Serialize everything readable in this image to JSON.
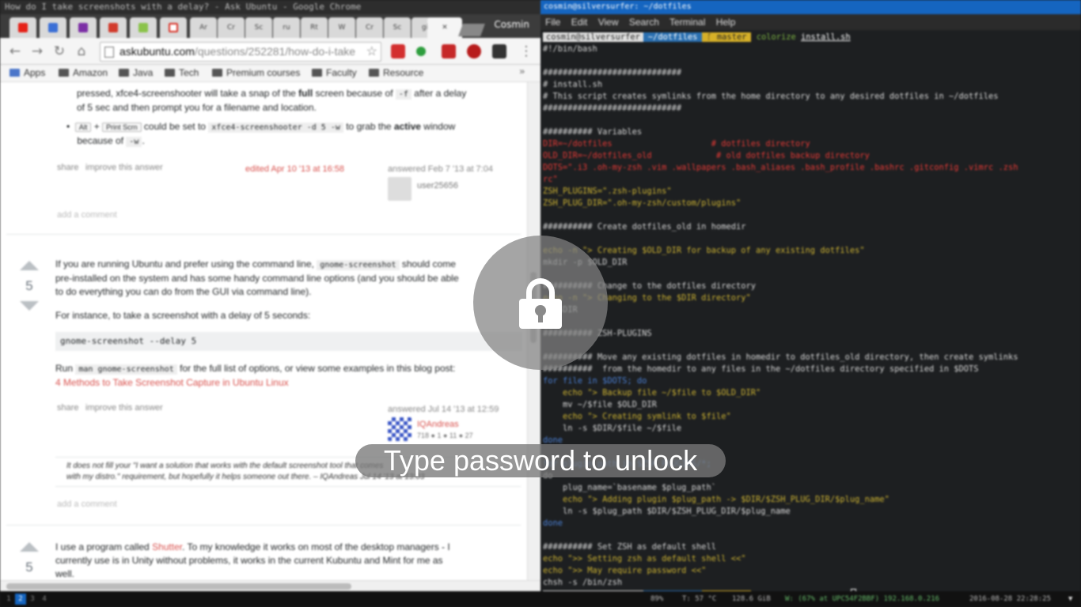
{
  "browser": {
    "title": "How do I take screenshots with a delay? - Ask Ubuntu - Google Chrome",
    "profile_name": "Cosmin",
    "tabs": [
      "Ar",
      "Cr",
      "Sc",
      "ru",
      "Rt",
      "W",
      "Cr",
      "Sc",
      "RI",
      "gi"
    ],
    "url_host": "askubuntu.com",
    "url_path": "/questions/252281/how-do-i-take",
    "bookmarks": [
      "Apps",
      "Amazon",
      "Java",
      "Tech",
      "Premium courses",
      "Faculty",
      "Resource"
    ],
    "bookmarks_more": "»"
  },
  "page": {
    "answer1": {
      "line1_pre": "pressed, xfce4-screenshooter will take a snap of the ",
      "line1_bold": "full",
      "line1_mid": " screen because of ",
      "line1_code": "-f",
      "line1_post": " after a delay",
      "line2": "of 5 sec and then prompt you for a filename and location.",
      "bullet_kbd1": "Alt",
      "bullet_eq": " + ",
      "bullet_kbd2": "Print Scrn",
      "bullet_text1": " could be set to ",
      "bullet_code": "xfce4-screenshooter -d 5 -w",
      "bullet_text2": " to grab the ",
      "bullet_bold": "active",
      "bullet_text3": " window",
      "bullet_line2_pre": "because of ",
      "bullet_line2_code": "-w",
      "bullet_line2_post": ".",
      "share": "share",
      "improve": "improve this answer",
      "edited": "edited Apr 10 '13 at 16:58",
      "answered": "answered Feb 7 '13 at 7:04",
      "user": "user25656",
      "add_comment": "add a comment"
    },
    "answer2": {
      "votes": "5",
      "p1_l1_pre": "If you are running Ubuntu and prefer using the command line, ",
      "p1_l1_code": "gnome-screenshot",
      "p1_l1_post": " should come",
      "p1_l2": "pre-installed on the system and has some handy command line options (and you should be able",
      "p1_l3": "to do everything you can do from the GUI via command line).",
      "p2": "For instance, to take a screenshot with a delay of 5 seconds:",
      "code": "gnome-screenshot --delay 5",
      "p3_pre": "Run ",
      "p3_code": "man gnome-screenshot",
      "p3_post": " for the full list of options, or view some examples in this blog post:",
      "p3_link": "4 Methods to Take Screenshot Capture in Ubuntu Linux",
      "share": "share",
      "improve": "improve this answer",
      "answered": "answered Jul 14 '13 at 12:59",
      "user": "IQAndreas",
      "rep": "718 ● 1 ● 11 ● 27",
      "comment_l1": "It does not fill your \"I want a solution that works with the default screenshot tool that comes",
      "comment_l2": "with my distro.\" requirement, but hopefully it helps someone out there. – IQAndreas  Jul 14 '13 at 13:03",
      "add_comment": "add a comment"
    },
    "answer3": {
      "votes": "5",
      "l1_pre": "I use a program called ",
      "l1_link": "Shutter",
      "l1_post": ". To my knowledge it works on most of the desktop managers - I",
      "l2": "currently use is in Unity without problems, it works in the current Kubuntu and Mint for me as",
      "l3": "well."
    }
  },
  "terminal": {
    "title": "cosmin@silversurfer: ~/dotfiles",
    "menu": [
      "File",
      "Edit",
      "View",
      "Search",
      "Terminal",
      "Help"
    ],
    "prompt_user": "cosmin@silversurfer",
    "prompt_dir": "~/dotfiles",
    "prompt_branch": "master",
    "prompt_cmd": "colorize",
    "prompt_arg": "install.sh",
    "lines": [
      {
        "c": "w",
        "t": "#!/bin/bash"
      },
      {
        "c": "w",
        "t": ""
      },
      {
        "c": "w",
        "t": "############################"
      },
      {
        "c": "w",
        "t": "# install.sh"
      },
      {
        "c": "w",
        "t": "# This script creates symlinks from the home directory to any desired dotfiles in ~/dotfiles"
      },
      {
        "c": "w",
        "t": "############################"
      },
      {
        "c": "w",
        "t": ""
      },
      {
        "c": "w",
        "t": "########## Variables"
      },
      {
        "c": "r",
        "t": "DIR=~/dotfiles                    # dotfiles directory"
      },
      {
        "c": "r",
        "t": "OLD_DIR=~/dotfiles_old             # old dotfiles backup directory"
      },
      {
        "c": "r",
        "t": "DOTS=\".i3 .oh-my-zsh .vim .wallpapers .bash_aliases .bash_profile .bashrc .gitconfig .vimrc .zsh"
      },
      {
        "c": "r",
        "t": "rc\""
      },
      {
        "c": "y",
        "t": "ZSH_PLUGINS=\".zsh-plugins\""
      },
      {
        "c": "y",
        "t": "ZSH_PLUG_DIR=\".oh-my-zsh/custom/plugins\""
      },
      {
        "c": "w",
        "t": ""
      },
      {
        "c": "w",
        "t": "########## Create dotfiles_old in homedir"
      },
      {
        "c": "w",
        "t": ""
      },
      {
        "c": "y",
        "t": "echo -n \"> Creating $OLD_DIR for backup of any existing dotfiles\""
      },
      {
        "c": "w",
        "t": "mkdir -p $OLD_DIR"
      },
      {
        "c": "w",
        "t": ""
      },
      {
        "c": "w",
        "t": "########## Change to the dotfiles directory"
      },
      {
        "c": "y",
        "t": "echo -n \"> Changing to the $DIR directory\""
      },
      {
        "c": "w",
        "t": "cd $DIR"
      },
      {
        "c": "w",
        "t": ""
      },
      {
        "c": "w",
        "t": "########## ZSH-PLUGINS"
      },
      {
        "c": "w",
        "t": ""
      },
      {
        "c": "w",
        "t": "########## Move any existing dotfiles in homedir to dotfiles_old directory, then create symlinks"
      },
      {
        "c": "w",
        "t": "##########  from the homedir to any files in the ~/dotfiles directory specified in $DOTS"
      },
      {
        "c": "b",
        "t": "for file in $DOTS; do"
      },
      {
        "c": "y",
        "t": "    echo \"> Backup file ~/$file to $OLD_DIR\""
      },
      {
        "c": "w",
        "t": "    mv ~/$file $OLD_DIR"
      },
      {
        "c": "y",
        "t": "    echo \"> Creating symlink to $file\""
      },
      {
        "c": "w",
        "t": "    ln -s $DIR/$file ~/$file"
      },
      {
        "c": "b",
        "t": "done"
      },
      {
        "c": "w",
        "t": ""
      },
      {
        "c": "b",
        "t": "for plugin_path in $ZSH_PLUGINS/*;"
      },
      {
        "c": "w",
        "t": "do"
      },
      {
        "c": "w",
        "t": "    plug_name=`basename $plug_path`"
      },
      {
        "c": "y",
        "t": "    echo \"> Adding plugin $plug_path -> $DIR/$ZSH_PLUG_DIR/$plug_name\""
      },
      {
        "c": "w",
        "t": "    ln -s $plug_path $DIR/$ZSH_PLUG_DIR/$plug_name"
      },
      {
        "c": "b",
        "t": "done"
      },
      {
        "c": "w",
        "t": ""
      },
      {
        "c": "w",
        "t": "########## Set ZSH as default shell"
      },
      {
        "c": "y",
        "t": "echo \">> Setting zsh as default shell <<\""
      },
      {
        "c": "y",
        "t": "echo \">> May require password <<\""
      },
      {
        "c": "w",
        "t": "chsh -s /bin/zsh"
      }
    ]
  },
  "taskbar": {
    "workspaces": [
      "1",
      "2",
      "3",
      "4"
    ],
    "active_workspace": "2",
    "battery": "89%",
    "temp": "T: 57 °C",
    "disk": "128.6 GiB",
    "wifi": "W: (67% at UPC54F2BBF) 192.168.0.216",
    "datetime": "2016-08-28 22:28:25"
  },
  "lock": {
    "icon": "lock-icon",
    "prompt": "Type password to unlock"
  },
  "colors": {
    "terminal_bg": "#1d1f21",
    "title_blue": "#1565c0",
    "link_red": "#d9534f",
    "powerline_yellow": "#d6b028"
  }
}
